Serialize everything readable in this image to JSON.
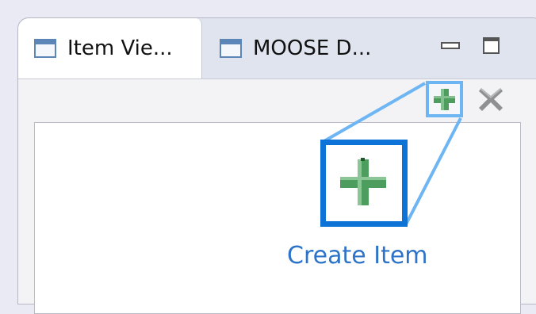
{
  "tabs": [
    {
      "label": "Item Vie...",
      "icon": "view-window-icon",
      "active": true
    },
    {
      "label": "MOOSE D...",
      "icon": "view-window-icon",
      "active": false
    }
  ],
  "window_controls": {
    "minimize": "minimize-icon",
    "maximize": "maximize-icon"
  },
  "toolbar": {
    "add": {
      "icon": "add-plus-icon",
      "highlighted": true
    },
    "remove": {
      "icon": "delete-x-icon",
      "enabled": false
    }
  },
  "callout": {
    "label": "Create Item",
    "icon": "add-plus-icon"
  },
  "colors": {
    "highlight_border": "#0e73d6",
    "callout_line": "#6db5f3",
    "plus_green": "#4d9d5f",
    "label_blue": "#2d74c8"
  }
}
